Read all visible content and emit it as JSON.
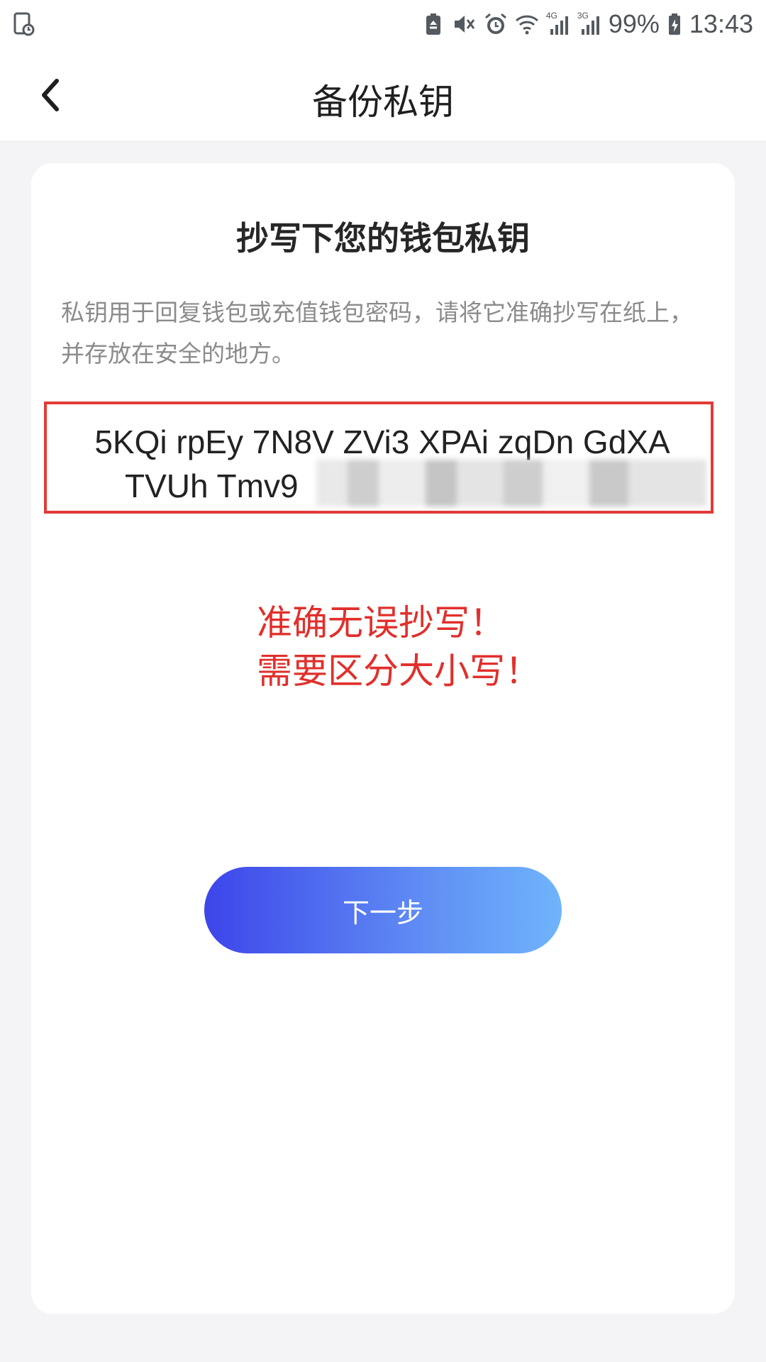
{
  "status_bar": {
    "battery_percent": "99%",
    "time": "13:43",
    "network_labels": [
      "4G",
      "3G"
    ],
    "icons": [
      "screen-timer-icon",
      "battery-saver-icon",
      "mute-icon",
      "alarm-icon",
      "wifi-icon",
      "signal-4g-icon",
      "signal-3g-icon",
      "battery-icon"
    ]
  },
  "header": {
    "title": "备份私钥",
    "back_icon": "chevron-left-icon"
  },
  "card": {
    "heading": "抄写下您的钱包私钥",
    "description": "私钥用于回复钱包或充值钱包密码，请将它准确抄写在纸上，并存放在安全的地方。",
    "private_key_line1": "5KQi rpEy 7N8V ZVi3 XPAi zqDn GdXA",
    "private_key_line2": "TVUh Tmv9",
    "warning_line1": "准确无误抄写！",
    "warning_line2": "需要区分大小写！",
    "next_button": "下一步"
  },
  "colors": {
    "highlight_red": "#e23a36",
    "button_gradient_start": "#3d45ea",
    "button_gradient_end": "#6fb4fb"
  }
}
